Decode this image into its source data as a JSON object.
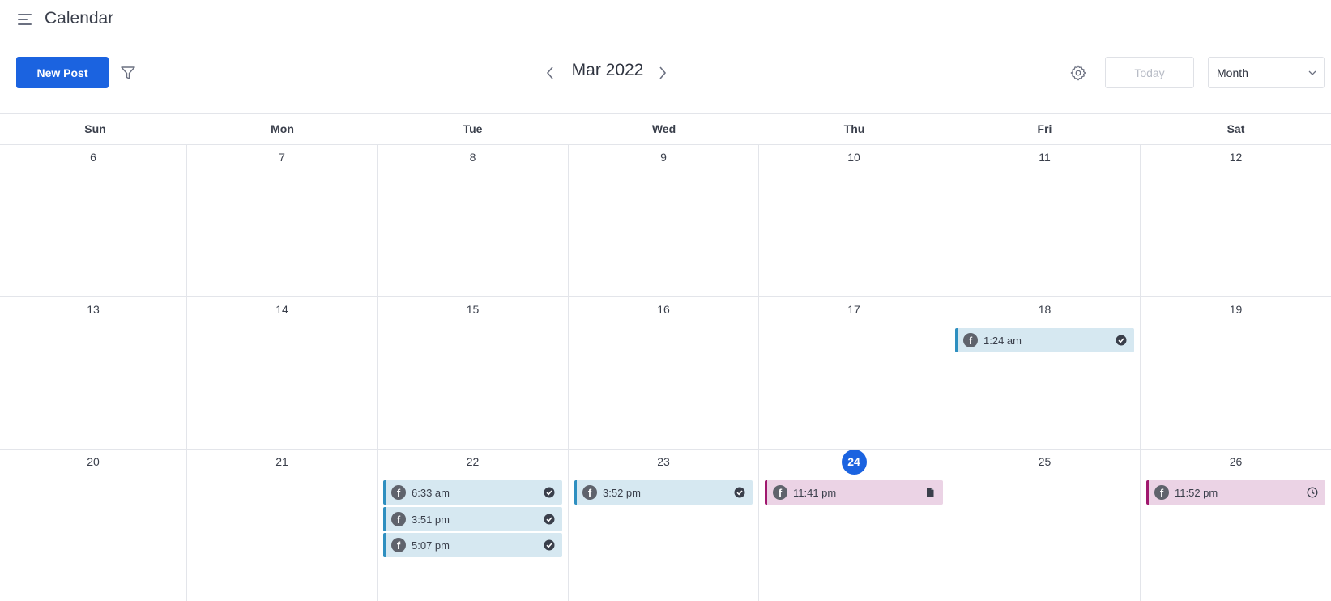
{
  "header": {
    "title": "Calendar"
  },
  "toolbar": {
    "new_post_label": "New Post",
    "month_label": "Mar 2022",
    "today_label": "Today",
    "view_value": "Month"
  },
  "weekdays": [
    "Sun",
    "Mon",
    "Tue",
    "Wed",
    "Thu",
    "Fri",
    "Sat"
  ],
  "weeks": [
    {
      "days": [
        "6",
        "7",
        "8",
        "9",
        "10",
        "11",
        "12"
      ]
    },
    {
      "days": [
        "13",
        "14",
        "15",
        "16",
        "17",
        "18",
        "19"
      ]
    },
    {
      "days": [
        "20",
        "21",
        "22",
        "23",
        "24",
        "25",
        "26"
      ]
    }
  ],
  "today": "24",
  "colors": {
    "accent": "#1b63e0",
    "published_bg": "#d6e8f1",
    "published_bar": "#2e8fc0",
    "draft_bg": "#ebd3e5",
    "draft_bar": "#a0186e"
  },
  "events": [
    {
      "week": 1,
      "day": 5,
      "time": "1:24 am",
      "network_icon": "facebook-icon",
      "status": "published"
    },
    {
      "week": 2,
      "day": 2,
      "time": "6:33 am",
      "network_icon": "facebook-icon",
      "status": "published"
    },
    {
      "week": 2,
      "day": 2,
      "time": "3:51 pm",
      "network_icon": "facebook-icon",
      "status": "published"
    },
    {
      "week": 2,
      "day": 2,
      "time": "5:07 pm",
      "network_icon": "facebook-icon",
      "status": "published"
    },
    {
      "week": 2,
      "day": 3,
      "time": "3:52 pm",
      "network_icon": "facebook-icon",
      "status": "published"
    },
    {
      "week": 2,
      "day": 4,
      "time": "11:41 pm",
      "network_icon": "facebook-icon",
      "status": "draft"
    },
    {
      "week": 2,
      "day": 6,
      "time": "11:52 pm",
      "network_icon": "facebook-icon",
      "status": "scheduled"
    }
  ]
}
